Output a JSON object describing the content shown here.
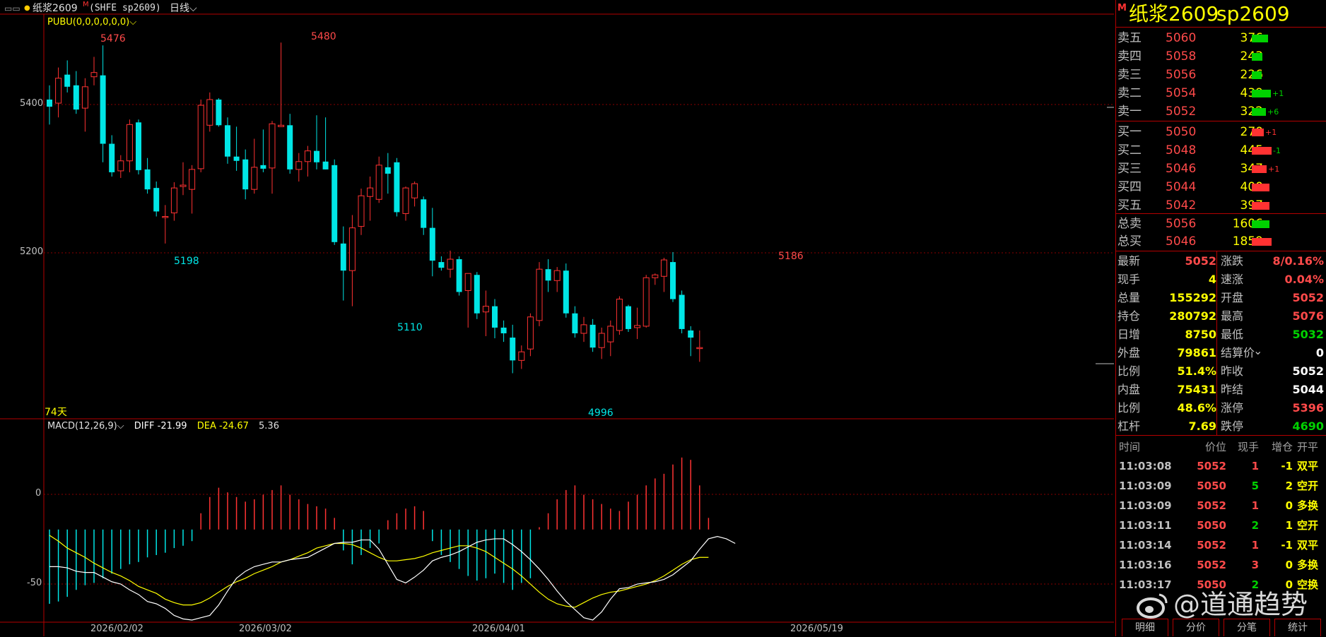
{
  "header": {
    "menu_icon": "menu-icon",
    "dot_icon": "dot-icon",
    "name": "纸浆2609",
    "m_flag": "M",
    "symbol": "(SHFE sp2609)",
    "period": "日线",
    "indicator": "PUBU(0,0,0,0,0,0)"
  },
  "chart": {
    "y_labels": [
      "5400",
      "5200"
    ],
    "hi_labels": [
      "5476",
      "5480",
      "5186"
    ],
    "lo_labels": [
      "5198",
      "5110",
      "4996"
    ],
    "days_label": "74天",
    "x_labels": [
      "2026/02/02",
      "2026/03/02",
      "2026/04/01",
      "2026/05/19"
    ],
    "macd_title": "MACD(12,26,9)",
    "diff_label": "DIFF -21.99",
    "dea_label": "DEA -24.67",
    "macd_value": "5.36",
    "macd_y_labels": [
      "0",
      "-50"
    ]
  },
  "chart_data": {
    "type": "candlestick",
    "ylim": [
      4960,
      5510
    ],
    "candles": [
      {
        "o": 5400,
        "h": 5420,
        "l": 5365,
        "c": 5390
      },
      {
        "o": 5395,
        "h": 5445,
        "l": 5375,
        "c": 5430
      },
      {
        "o": 5435,
        "h": 5455,
        "l": 5410,
        "c": 5418
      },
      {
        "o": 5420,
        "h": 5440,
        "l": 5380,
        "c": 5386
      },
      {
        "o": 5388,
        "h": 5430,
        "l": 5355,
        "c": 5418
      },
      {
        "o": 5432,
        "h": 5460,
        "l": 5420,
        "c": 5438
      },
      {
        "o": 5434,
        "h": 5476,
        "l": 5312,
        "c": 5338
      },
      {
        "o": 5338,
        "h": 5350,
        "l": 5292,
        "c": 5298
      },
      {
        "o": 5300,
        "h": 5322,
        "l": 5290,
        "c": 5314
      },
      {
        "o": 5314,
        "h": 5372,
        "l": 5298,
        "c": 5365
      },
      {
        "o": 5368,
        "h": 5372,
        "l": 5295,
        "c": 5301
      },
      {
        "o": 5302,
        "h": 5318,
        "l": 5268,
        "c": 5274
      },
      {
        "o": 5276,
        "h": 5285,
        "l": 5236,
        "c": 5243
      },
      {
        "o": 5236,
        "h": 5252,
        "l": 5198,
        "c": 5236
      },
      {
        "o": 5241,
        "h": 5284,
        "l": 5230,
        "c": 5276
      },
      {
        "o": 5278,
        "h": 5312,
        "l": 5266,
        "c": 5280
      },
      {
        "o": 5274,
        "h": 5308,
        "l": 5240,
        "c": 5302
      },
      {
        "o": 5303,
        "h": 5400,
        "l": 5298,
        "c": 5392
      },
      {
        "o": 5364,
        "h": 5410,
        "l": 5355,
        "c": 5400
      },
      {
        "o": 5400,
        "h": 5402,
        "l": 5362,
        "c": 5364
      },
      {
        "o": 5364,
        "h": 5375,
        "l": 5310,
        "c": 5320
      },
      {
        "o": 5320,
        "h": 5362,
        "l": 5300,
        "c": 5314
      },
      {
        "o": 5316,
        "h": 5330,
        "l": 5260,
        "c": 5274
      },
      {
        "o": 5274,
        "h": 5345,
        "l": 5268,
        "c": 5305
      },
      {
        "o": 5308,
        "h": 5358,
        "l": 5298,
        "c": 5303
      },
      {
        "o": 5304,
        "h": 5370,
        "l": 5268,
        "c": 5366
      },
      {
        "o": 5362,
        "h": 5480,
        "l": 5362,
        "c": 5364
      },
      {
        "o": 5364,
        "h": 5380,
        "l": 5296,
        "c": 5302
      },
      {
        "o": 5302,
        "h": 5325,
        "l": 5285,
        "c": 5313
      },
      {
        "o": 5313,
        "h": 5335,
        "l": 5292,
        "c": 5328
      },
      {
        "o": 5328,
        "h": 5378,
        "l": 5302,
        "c": 5312
      },
      {
        "o": 5313,
        "h": 5375,
        "l": 5302,
        "c": 5302
      },
      {
        "o": 5308,
        "h": 5316,
        "l": 5196,
        "c": 5200
      },
      {
        "o": 5198,
        "h": 5222,
        "l": 5118,
        "c": 5160
      },
      {
        "o": 5160,
        "h": 5238,
        "l": 5110,
        "c": 5220
      },
      {
        "o": 5222,
        "h": 5275,
        "l": 5210,
        "c": 5265
      },
      {
        "o": 5264,
        "h": 5292,
        "l": 5230,
        "c": 5276
      },
      {
        "o": 5260,
        "h": 5320,
        "l": 5255,
        "c": 5308
      },
      {
        "o": 5305,
        "h": 5325,
        "l": 5268,
        "c": 5296
      },
      {
        "o": 5312,
        "h": 5318,
        "l": 5236,
        "c": 5242
      },
      {
        "o": 5240,
        "h": 5278,
        "l": 5230,
        "c": 5276
      },
      {
        "o": 5262,
        "h": 5285,
        "l": 5250,
        "c": 5282
      },
      {
        "o": 5260,
        "h": 5264,
        "l": 5210,
        "c": 5220
      },
      {
        "o": 5220,
        "h": 5248,
        "l": 5152,
        "c": 5174
      },
      {
        "o": 5172,
        "h": 5180,
        "l": 5160,
        "c": 5164
      },
      {
        "o": 5162,
        "h": 5188,
        "l": 5150,
        "c": 5176
      },
      {
        "o": 5176,
        "h": 5180,
        "l": 5125,
        "c": 5130
      },
      {
        "o": 5132,
        "h": 5154,
        "l": 5080,
        "c": 5156
      },
      {
        "o": 5154,
        "h": 5158,
        "l": 5092,
        "c": 5100
      },
      {
        "o": 5102,
        "h": 5132,
        "l": 5068,
        "c": 5110
      },
      {
        "o": 5110,
        "h": 5120,
        "l": 5065,
        "c": 5080
      },
      {
        "o": 5080,
        "h": 5090,
        "l": 5060,
        "c": 5072
      },
      {
        "o": 5066,
        "h": 5084,
        "l": 5016,
        "c": 5034
      },
      {
        "o": 5034,
        "h": 5055,
        "l": 5022,
        "c": 5046
      },
      {
        "o": 5050,
        "h": 5100,
        "l": 5040,
        "c": 5095
      },
      {
        "o": 5090,
        "h": 5172,
        "l": 5082,
        "c": 5162
      },
      {
        "o": 5162,
        "h": 5176,
        "l": 5130,
        "c": 5146
      },
      {
        "o": 5146,
        "h": 5165,
        "l": 5130,
        "c": 5160
      },
      {
        "o": 5160,
        "h": 5170,
        "l": 5094,
        "c": 5100
      },
      {
        "o": 5100,
        "h": 5110,
        "l": 5066,
        "c": 5072
      },
      {
        "o": 5072,
        "h": 5095,
        "l": 5060,
        "c": 5084
      },
      {
        "o": 5084,
        "h": 5092,
        "l": 5046,
        "c": 5052
      },
      {
        "o": 5052,
        "h": 5080,
        "l": 5036,
        "c": 5072
      },
      {
        "o": 5060,
        "h": 5090,
        "l": 5040,
        "c": 5082
      },
      {
        "o": 5076,
        "h": 5124,
        "l": 5070,
        "c": 5120
      },
      {
        "o": 5110,
        "h": 5112,
        "l": 5074,
        "c": 5078
      },
      {
        "o": 5080,
        "h": 5108,
        "l": 5064,
        "c": 5083
      },
      {
        "o": 5082,
        "h": 5154,
        "l": 5080,
        "c": 5150
      },
      {
        "o": 5150,
        "h": 5156,
        "l": 5140,
        "c": 5154
      },
      {
        "o": 5152,
        "h": 5178,
        "l": 5130,
        "c": 5175
      },
      {
        "o": 5172,
        "h": 5186,
        "l": 5116,
        "c": 5120
      },
      {
        "o": 5126,
        "h": 5132,
        "l": 5072,
        "c": 5078
      },
      {
        "o": 5076,
        "h": 5082,
        "l": 5040,
        "c": 5066
      },
      {
        "o": 5052,
        "h": 5076,
        "l": 5032,
        "c": 5052
      }
    ],
    "macd": {
      "ylim": [
        -78,
        82
      ],
      "hist": [
        -64,
        -62,
        -58,
        -52,
        -48,
        -46,
        -42,
        -38,
        -34,
        -30,
        -28,
        -24,
        -22,
        -20,
        -16,
        -14,
        -10,
        14,
        28,
        36,
        32,
        28,
        24,
        26,
        30,
        34,
        38,
        30,
        26,
        22,
        20,
        18,
        10,
        -18,
        -30,
        -22,
        -16,
        -12,
        8,
        14,
        18,
        20,
        16,
        -10,
        -22,
        -28,
        -34,
        -40,
        -44,
        -42,
        -38,
        -46,
        -52,
        -46,
        -42,
        2,
        14,
        26,
        34,
        38,
        30,
        26,
        22,
        18,
        16,
        24,
        30,
        38,
        44,
        48,
        56,
        62,
        60,
        38,
        10
      ],
      "diff": [
        -32,
        -32,
        -33,
        -36,
        -37,
        -37,
        -41,
        -45,
        -47,
        -52,
        -56,
        -62,
        -64,
        -68,
        -74,
        -77,
        -78,
        -76,
        -74,
        -65,
        -53,
        -42,
        -36,
        -32,
        -30,
        -28,
        -28,
        -26,
        -25,
        -24,
        -20,
        -16,
        -12,
        -11,
        -11,
        -9,
        -9,
        -17,
        -30,
        -43,
        -46,
        -41,
        -35,
        -27,
        -24,
        -22,
        -19,
        -15,
        -11,
        -9,
        -8,
        -8,
        -13,
        -19,
        -26,
        -34,
        -43,
        -53,
        -62,
        -69,
        -76,
        -78,
        -71,
        -60,
        -51,
        -50,
        -47,
        -46,
        -45,
        -43,
        -39,
        -33,
        -27,
        -17,
        -8,
        -6,
        -8,
        -12
      ],
      "dea": [
        -5,
        -10,
        -16,
        -20,
        -24,
        -29,
        -33,
        -37,
        -40,
        -44,
        -49,
        -52,
        -55,
        -60,
        -63,
        -65,
        -65,
        -63,
        -59,
        -54,
        -49,
        -45,
        -42,
        -38,
        -35,
        -32,
        -28,
        -26,
        -23,
        -20,
        -16,
        -14,
        -12,
        -12,
        -13,
        -16,
        -20,
        -24,
        -27,
        -27,
        -26,
        -25,
        -23,
        -20,
        -18,
        -16,
        -14,
        -14,
        -16,
        -19,
        -24,
        -29,
        -34,
        -40,
        -47,
        -54,
        -60,
        -64,
        -66,
        -67,
        -63,
        -59,
        -56,
        -54,
        -53,
        -51,
        -49,
        -47,
        -44,
        -40,
        -35,
        -30,
        -26,
        -24,
        -24
      ]
    }
  },
  "panel": {
    "m_flag": "M",
    "title_name": "纸浆2609",
    "title_code": "sp2609",
    "asks": [
      {
        "label": "卖五",
        "price": "5060",
        "vol": "376",
        "bar": 0.23,
        "chg": ""
      },
      {
        "label": "卖四",
        "price": "5058",
        "vol": "243",
        "bar": 0.15,
        "chg": ""
      },
      {
        "label": "卖三",
        "price": "5056",
        "vol": "226",
        "bar": 0.14,
        "chg": ""
      },
      {
        "label": "卖二",
        "price": "5054",
        "vol": "439",
        "bar": 0.27,
        "chg": "+1"
      },
      {
        "label": "卖一",
        "price": "5052",
        "vol": "322",
        "bar": 0.2,
        "chg": "+6"
      }
    ],
    "bids": [
      {
        "label": "买一",
        "price": "5050",
        "vol": "270",
        "bar": 0.17,
        "chg": "+1"
      },
      {
        "label": "买二",
        "price": "5048",
        "vol": "445",
        "bar": 0.28,
        "chg": "-1"
      },
      {
        "label": "买三",
        "price": "5046",
        "vol": "347",
        "bar": 0.21,
        "chg": "+1"
      },
      {
        "label": "买四",
        "price": "5044",
        "vol": "400",
        "bar": 0.25,
        "chg": ""
      },
      {
        "label": "买五",
        "price": "5042",
        "vol": "397",
        "bar": 0.25,
        "chg": ""
      }
    ],
    "totals": [
      {
        "label": "总卖",
        "price": "5056",
        "vol": "1606",
        "bar": 0.25,
        "color": "#00d200"
      },
      {
        "label": "总买",
        "price": "5046",
        "vol": "1859",
        "bar": 0.28,
        "color": "#ff3232"
      }
    ],
    "quote": [
      {
        "l": "最新",
        "lv": "5052",
        "lc": "#ff4a4a",
        "r": "涨跌",
        "rv": "8/0.16%",
        "rc": "#ff4a4a"
      },
      {
        "l": "现手",
        "lv": "4",
        "lc": "#ffff00",
        "r": "速涨",
        "rv": "0.04%",
        "rc": "#ff4a4a"
      },
      {
        "l": "总量",
        "lv": "155292",
        "lc": "#ffff00",
        "r": "开盘",
        "rv": "5052",
        "rc": "#ff4a4a"
      },
      {
        "l": "持仓",
        "lv": "280792",
        "lc": "#ffff00",
        "r": "最高",
        "rv": "5076",
        "rc": "#ff4a4a"
      },
      {
        "l": "日增",
        "lv": "8750",
        "lc": "#ffff00",
        "r": "最低",
        "rv": "5032",
        "rc": "#00d200"
      },
      {
        "l": "外盘",
        "lv": "79861",
        "lc": "#ffff00",
        "r": "结算价",
        "rv": "0",
        "rc": "#ffffff"
      },
      {
        "l": "比例",
        "lv": "51.4%",
        "lc": "#ffff00",
        "r": "昨收",
        "rv": "5052",
        "rc": "#ffffff"
      },
      {
        "l": "内盘",
        "lv": "75431",
        "lc": "#ffff00",
        "r": "昨结",
        "rv": "5044",
        "rc": "#ffffff"
      },
      {
        "l": "比例",
        "lv": "48.6%",
        "lc": "#ffff00",
        "r": "涨停",
        "rv": "5396",
        "rc": "#ff4a4a"
      },
      {
        "l": "杠杆",
        "lv": "7.69",
        "lc": "#ffff00",
        "r": "跌停",
        "rv": "4690",
        "rc": "#00d200"
      }
    ],
    "trade_head": {
      "time": "时间",
      "price": "价位",
      "qty": "现手",
      "zc": "增仓",
      "kp": "开平"
    },
    "trades": [
      {
        "time": "11:03:08",
        "price": "5052",
        "pc": "#ff4a4a",
        "qty": "1",
        "qc": "#ff4a4a",
        "zc": "-1",
        "kp": "双平"
      },
      {
        "time": "11:03:09",
        "price": "5050",
        "pc": "#ff4a4a",
        "qty": "5",
        "qc": "#00d200",
        "zc": "2",
        "kp": "空开"
      },
      {
        "time": "11:03:09",
        "price": "5052",
        "pc": "#ff4a4a",
        "qty": "1",
        "qc": "#ff4a4a",
        "zc": "0",
        "kp": "多换"
      },
      {
        "time": "11:03:11",
        "price": "5050",
        "pc": "#ff4a4a",
        "qty": "2",
        "qc": "#00d200",
        "zc": "1",
        "kp": "空开"
      },
      {
        "time": "11:03:14",
        "price": "5052",
        "pc": "#ff4a4a",
        "qty": "1",
        "qc": "#ff4a4a",
        "zc": "-1",
        "kp": "双平"
      },
      {
        "time": "11:03:16",
        "price": "5052",
        "pc": "#ff4a4a",
        "qty": "3",
        "qc": "#ff4a4a",
        "zc": "0",
        "kp": "多换"
      },
      {
        "time": "11:03:17",
        "price": "5050",
        "pc": "#ff4a4a",
        "qty": "2",
        "qc": "#00d200",
        "zc": "0",
        "kp": "空换"
      }
    ],
    "tabs": [
      "明细",
      "分价",
      "分笔",
      "统计"
    ],
    "watermark": "@道通趋势"
  },
  "colors": {
    "up": "#ff3232",
    "down": "#00e6e6",
    "frame": "#b40000",
    "diff": "#ffffff",
    "dea": "#ffff00"
  }
}
